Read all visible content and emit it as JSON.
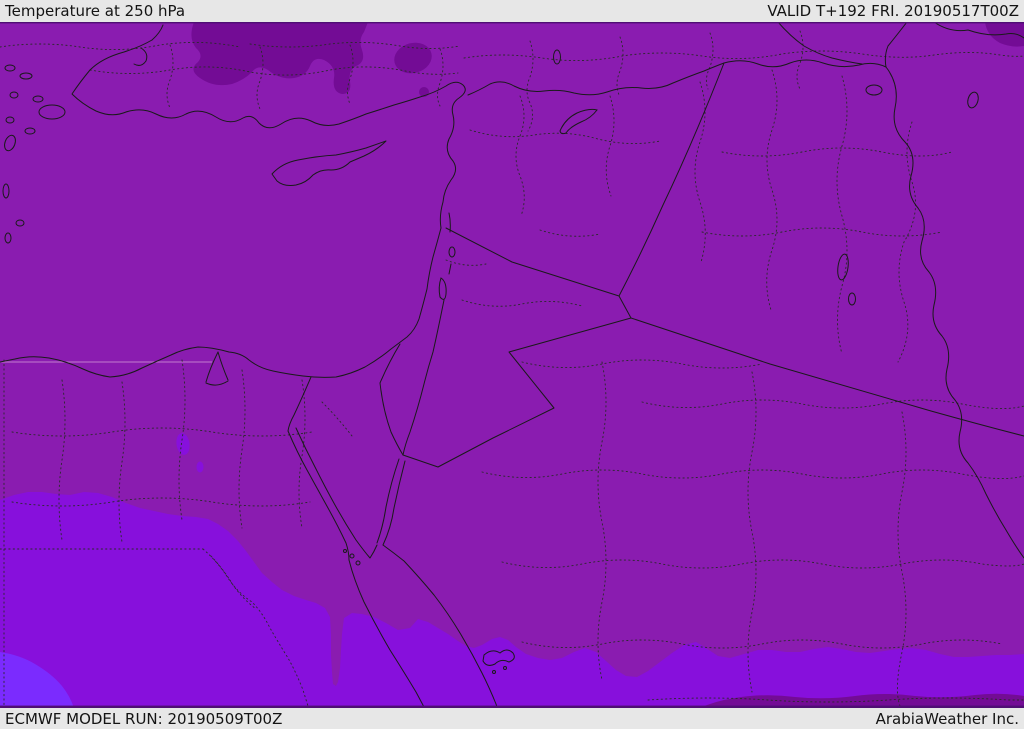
{
  "header": {
    "title": "Temperature at 250 hPa",
    "valid_label": "VALID T+192 FRI. 20190517T00Z"
  },
  "footer": {
    "model_run_label": "ECMWF MODEL RUN: 20190509T00Z",
    "branding_label": "ArabiaWeather Inc."
  },
  "map": {
    "description": "Temperature shading at 250 hPa over the Middle East and Eastern Mediterranean with coastlines, country borders and dotted administrative boundaries",
    "colors": {
      "shade_dark": "#730C95",
      "shade_base": "#8A1CB0",
      "shade_bright": "#8710DC",
      "shade_brightest": "#7B2BFE",
      "coast_line": "#1A1A1A",
      "admin_line": "#2A2A2A",
      "graticule": "#E9BBE2",
      "map_edge": "#4F0E74",
      "bar_bg": "#E7E7E7",
      "bar_text": "#141414"
    }
  }
}
